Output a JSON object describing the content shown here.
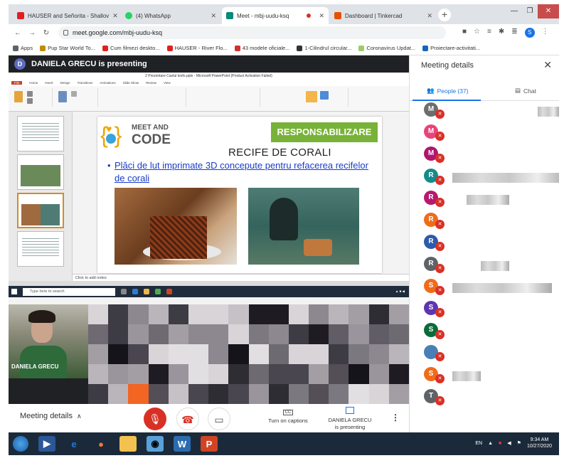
{
  "browser": {
    "tabs": [
      {
        "label": "HAUSER and Señorita - Shallov",
        "fav": "#e02020"
      },
      {
        "label": "(4) WhatsApp",
        "fav": "#25d366"
      },
      {
        "label": "Meet - mbj-uudu-ksq",
        "fav": "#00897b"
      },
      {
        "label": "Dashboard | Tinkercad",
        "fav": "#e65100"
      }
    ],
    "url": "meet.google.com/mbj-uudu-ksq",
    "bookmarks": [
      {
        "label": "Apps",
        "color": "#5f6368"
      },
      {
        "label": "Pup Star World To...",
        "color": "#c28b00"
      },
      {
        "label": "Cum filmezi deskto...",
        "color": "#e02020"
      },
      {
        "label": "HAUSER - River Flo...",
        "color": "#e02020"
      },
      {
        "label": "43 modele oficiale...",
        "color": "#d32f2f"
      },
      {
        "label": "1-Cilindrul circular...",
        "color": "#333"
      },
      {
        "label": "Coronavirus Updat...",
        "color": "#9ccc65"
      },
      {
        "label": "Proiectare-activitati...",
        "color": "#1565c0"
      }
    ]
  },
  "meet": {
    "presenter_banner": "DANIELA GRECU is presenting",
    "presenter_initial": "D",
    "self_label": "DANIELA GRECU",
    "controls": {
      "meeting_details": "Meeting details",
      "captions": "Turn on captions",
      "cc": "CC",
      "presenting_name": "DANIELA GRECU",
      "presenting_status": "is presenting"
    }
  },
  "slide": {
    "ppt_title": "2 Prezentare Castul tesfo.pptx - Microsoft PowerPoint (Product Activation Failed)",
    "ribbon_tabs": [
      "File",
      "Home",
      "Insert",
      "Design",
      "Transitions",
      "Animations",
      "Slide Show",
      "Review",
      "View"
    ],
    "logo_line1": "MEET AND",
    "logo_line2": "CODE",
    "badge": "RESPONSABILIZARE",
    "title": "RECIFE DE CORALI",
    "bullet": "Plăci de lut imprimate 3D concepute pentru refacerea recifelor de corali",
    "notes": "Click to add notes",
    "search": "Type here to search"
  },
  "panel": {
    "title": "Meeting details",
    "people_tab": "People (37)",
    "chat_tab": "Chat",
    "participants": [
      {
        "initial": "M",
        "color": "#6d6d6d"
      },
      {
        "initial": "M",
        "color": "#e8437b"
      },
      {
        "initial": "M",
        "color": "#b0166d"
      },
      {
        "initial": "R",
        "color": "#138c8a"
      },
      {
        "initial": "R",
        "color": "#b8196e"
      },
      {
        "initial": "R",
        "color": "#ef6c1a"
      },
      {
        "initial": "R",
        "color": "#2e5aac"
      },
      {
        "initial": "R",
        "color": "#5f6368"
      },
      {
        "initial": "S",
        "color": "#ef6c1a"
      },
      {
        "initial": "S",
        "color": "#5e35b1"
      },
      {
        "initial": "S",
        "color": "#0b6b3a"
      },
      {
        "initial": "",
        "color": "#4a7fb5"
      },
      {
        "initial": "S",
        "color": "#ef6c1a"
      },
      {
        "initial": "T",
        "color": "#5f6368"
      }
    ]
  },
  "taskbar": {
    "lang": "EN",
    "time": "9:34 AM",
    "date": "10/27/2020"
  }
}
